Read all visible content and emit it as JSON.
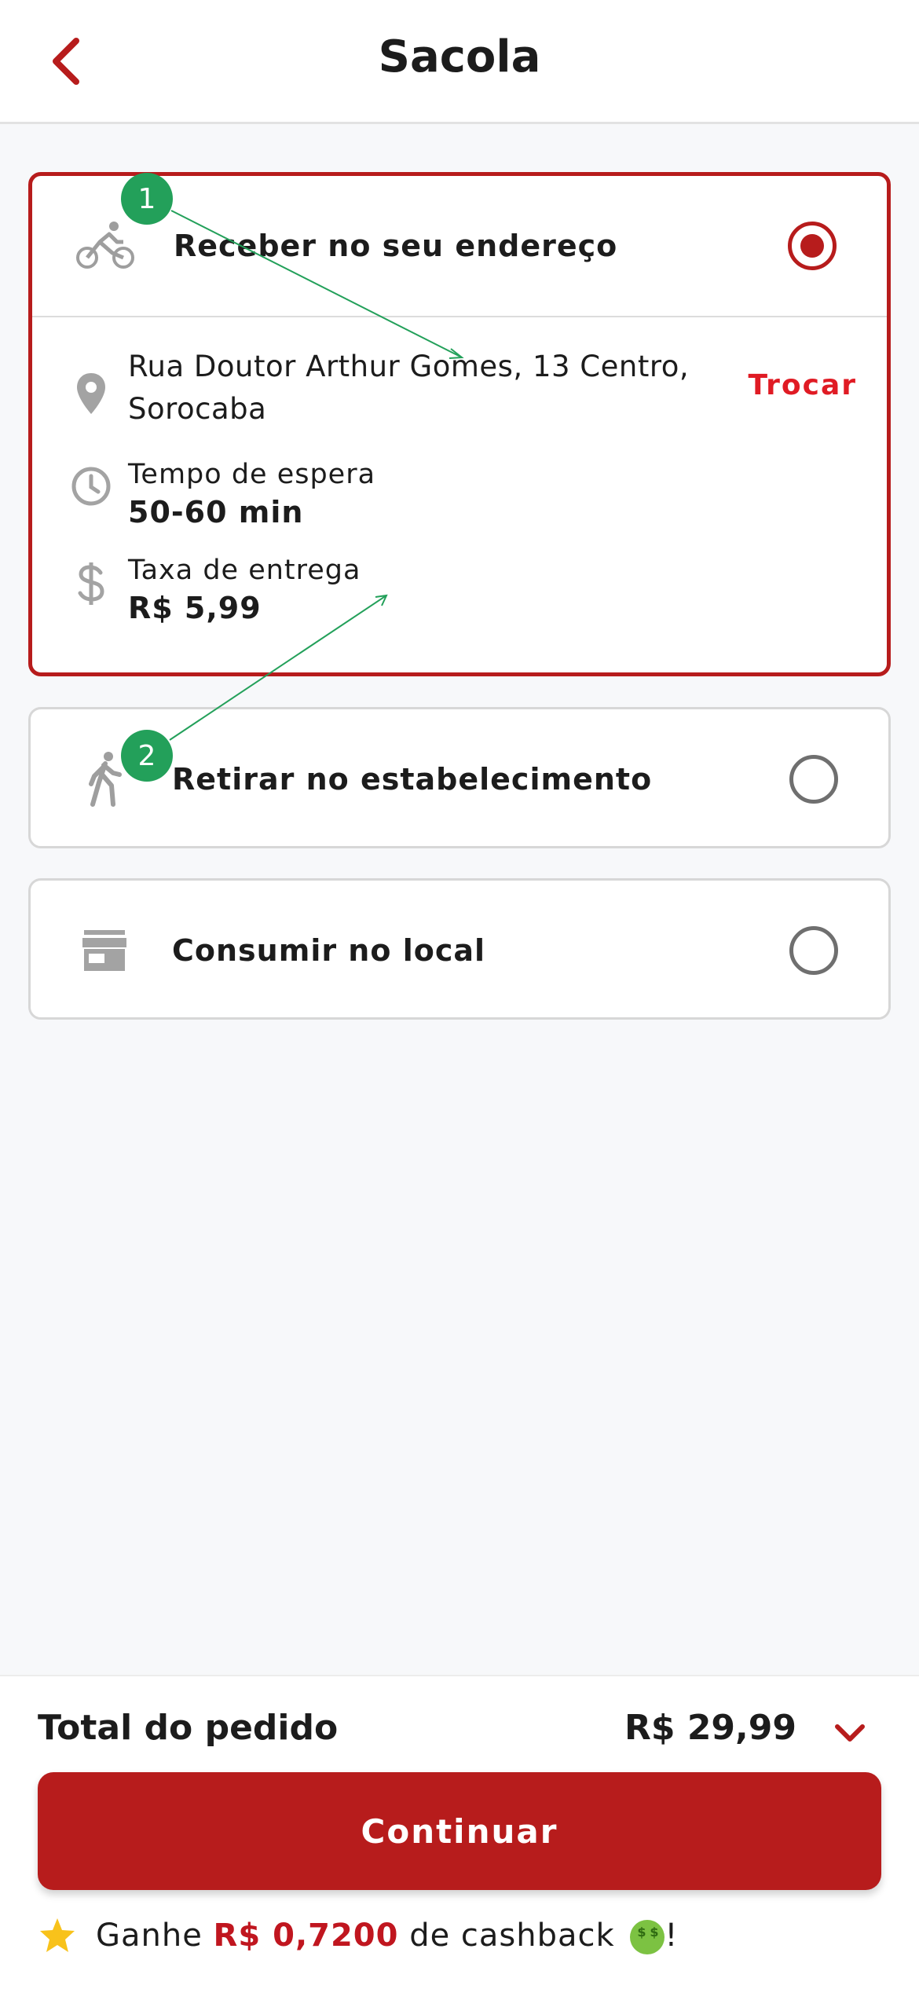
{
  "header": {
    "title": "Sacola"
  },
  "options": [
    {
      "label": "Receber no seu endereço",
      "icon": "bicycle-icon",
      "selected": true,
      "details": {
        "address": "Rua Doutor Arthur Gomes, 13 Centro, Sorocaba",
        "change_label": "Trocar",
        "wait_label": "Tempo de espera",
        "wait_value": "50-60 min",
        "fee_label": "Taxa de entrega",
        "fee_value": "R$ 5,99"
      }
    },
    {
      "label": "Retirar no estabelecimento",
      "icon": "walking-person-icon",
      "selected": false
    },
    {
      "label": "Consumir no local",
      "icon": "store-icon",
      "selected": false
    }
  ],
  "annotations": [
    "1",
    "2"
  ],
  "footer": {
    "total_label": "Total do pedido",
    "total_value": "R$ 29,99",
    "continue_label": "Continuar",
    "cashback_prefix": "Ganhe",
    "cashback_amount": "R$ 0,7200",
    "cashback_suffix": "de cashback",
    "cashback_end": "!"
  },
  "colors": {
    "accent": "#b71c1c",
    "link": "#e01b24",
    "badge": "#23a05a"
  }
}
